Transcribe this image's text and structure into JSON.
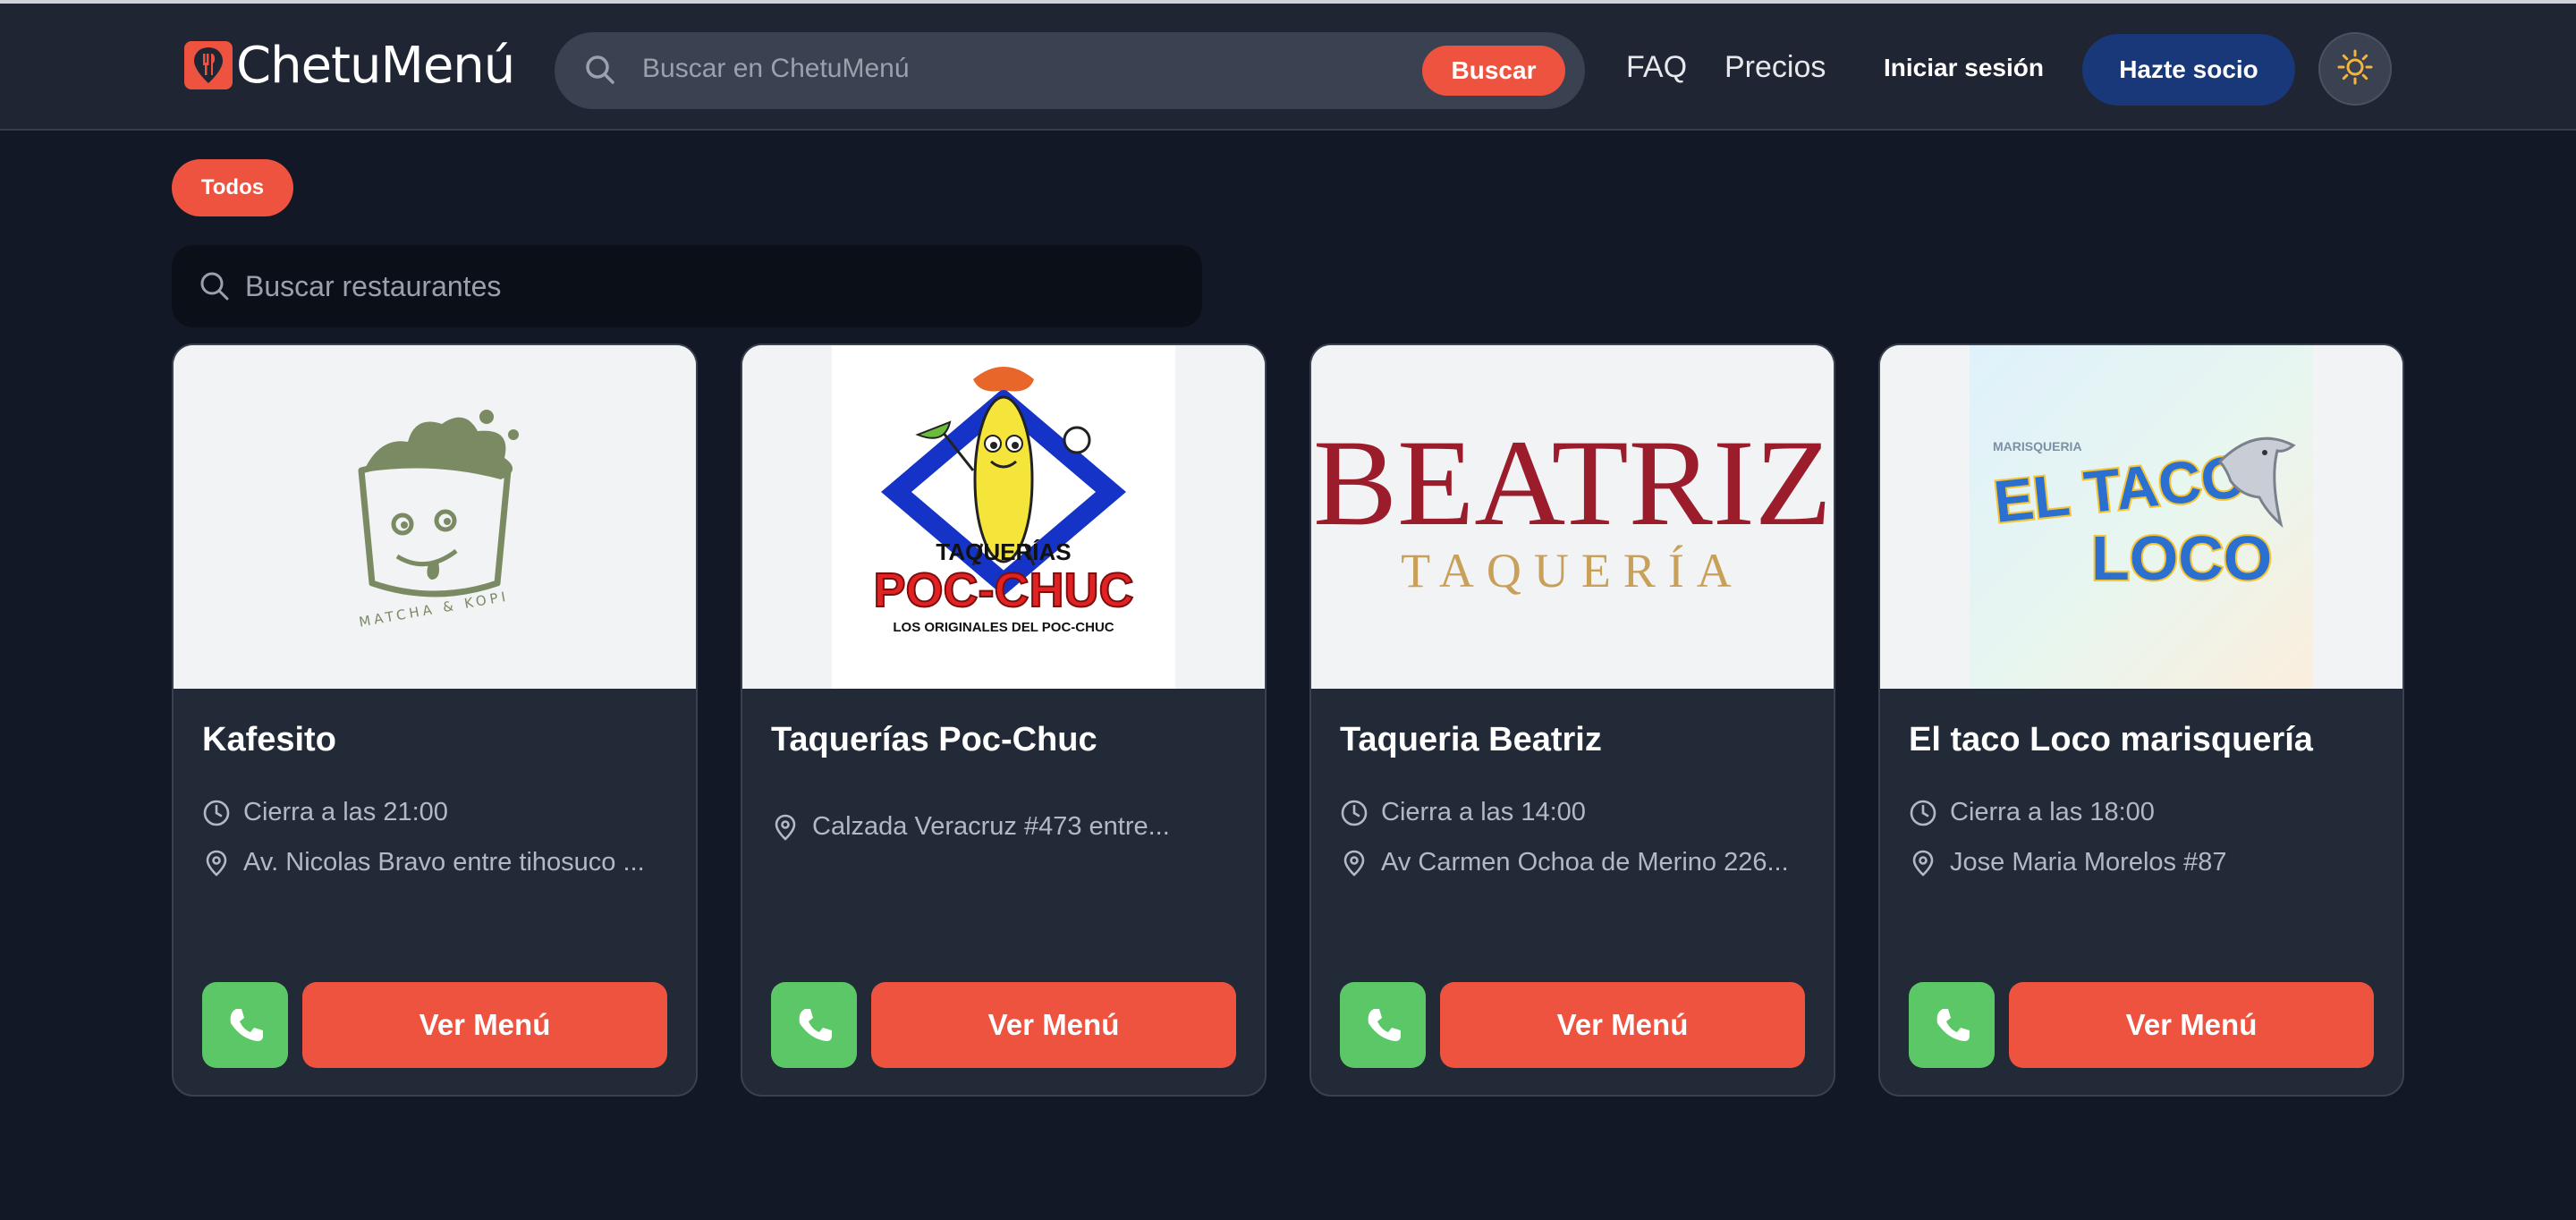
{
  "header": {
    "brand": "ChetuMenú",
    "search_placeholder": "Buscar en ChetuMenú",
    "search_button": "Buscar",
    "nav": [
      "FAQ",
      "Precios"
    ],
    "login": "Iniciar sesión",
    "signup": "Hazte socio"
  },
  "filters": {
    "chip_all": "Todos"
  },
  "restaurant_search": {
    "placeholder": "Buscar restaurantes"
  },
  "restaurants": [
    {
      "name": "Kafesito",
      "hours": "Cierra a las 21:00",
      "address": "Av. Nicolas Bravo entre tihosuco ...",
      "menu_button": "Ver Menú",
      "logo_text": "MATCHA & KOPI"
    },
    {
      "name": "Taquerías Poc-Chuc",
      "address": "Calzada Veracruz #473 entre...",
      "menu_button": "Ver Menú",
      "logo_text": [
        "TAQUERÍAS",
        "POC-CHUC",
        "LOS ORIGINALES DEL POC-CHUC"
      ]
    },
    {
      "name": "Taqueria Beatriz",
      "hours": "Cierra a las 14:00",
      "address": "Av Carmen Ochoa de Merino 226...",
      "menu_button": "Ver Menú",
      "logo_text": [
        "BEATRIZ",
        "TAQUERÍA"
      ]
    },
    {
      "name": "El taco Loco marisquería",
      "hours": "Cierra a las 18:00",
      "address": "Jose Maria Morelos #87",
      "menu_button": "Ver Menú",
      "logo_text": [
        "MARISQUERIA",
        "EL TACO",
        "LOCO"
      ]
    }
  ],
  "colors": {
    "accent": "#ee5340",
    "phone_green": "#5cc766",
    "signup_blue": "#18387a",
    "page_bg": "#121826",
    "card_bg": "#222a38"
  },
  "icons": [
    "search-icon",
    "sun-icon",
    "clock-icon",
    "map-pin-icon",
    "phone-icon",
    "fork-knife-icon"
  ]
}
